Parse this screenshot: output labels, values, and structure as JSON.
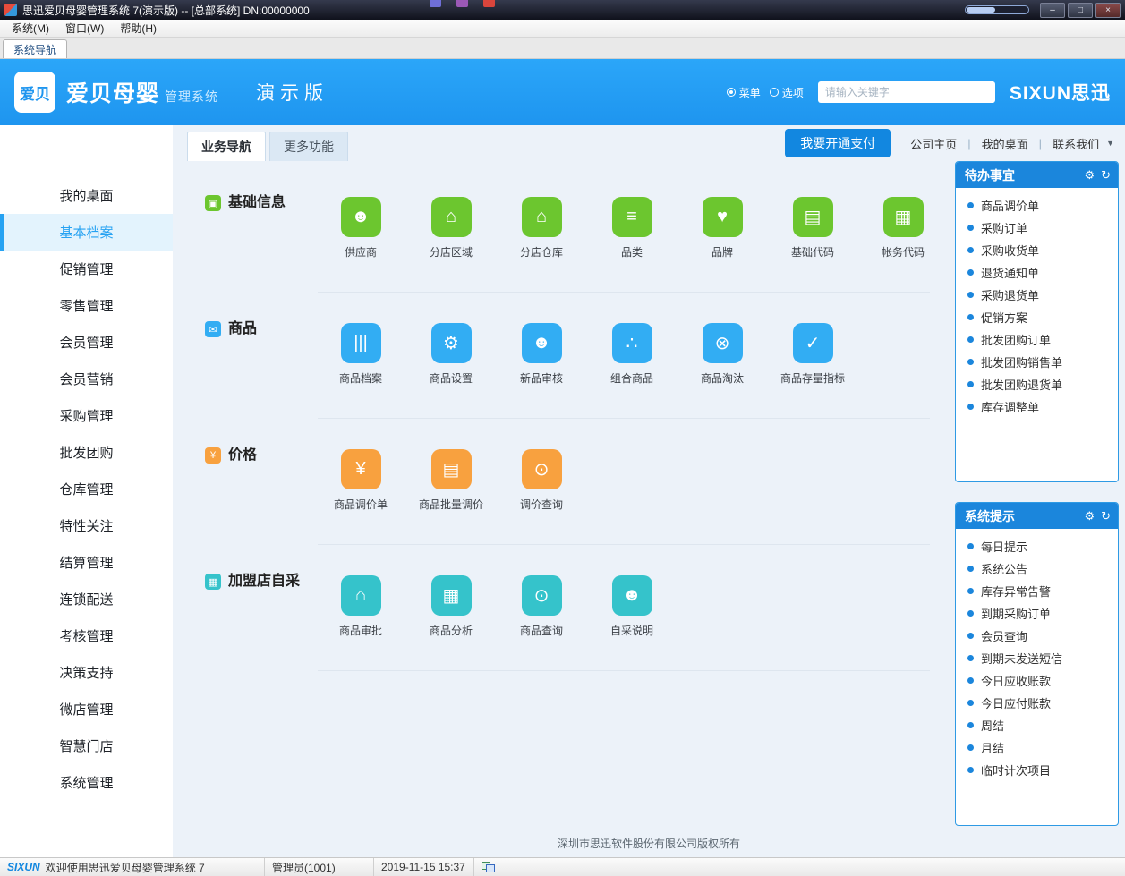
{
  "titlebar": {
    "title": "思迅爱贝母婴管理系统 7(演示版) -- [总部系统] DN:00000000",
    "controls": {
      "minimize": "–",
      "maximize": "□",
      "close": "×"
    },
    "peek_icon_colors": [
      "#6f6fd8",
      "#9b59b6",
      "#d9453c"
    ]
  },
  "menubar": {
    "items": [
      "系统(M)",
      "窗口(W)",
      "帮助(H)"
    ]
  },
  "nav_tab": "系统导航",
  "banner": {
    "logo_badge": "爱贝",
    "brand": "爱贝母婴",
    "brand_suffix": "管理系统",
    "demo_label": "演示版",
    "radio_options": [
      {
        "label": "菜单",
        "selected": true
      },
      {
        "label": "选项",
        "selected": false
      }
    ],
    "search_placeholder": "请输入关键字",
    "vendor_logo": "SIXUN思迅"
  },
  "sidebar": {
    "active": "基本档案",
    "items": [
      "我的桌面",
      "基本档案",
      "促销管理",
      "零售管理",
      "会员管理",
      "会员营销",
      "采购管理",
      "批发团购",
      "仓库管理",
      "特性关注",
      "结算管理",
      "连锁配送",
      "考核管理",
      "决策支持",
      "微店管理",
      "智慧门店",
      "系统管理"
    ]
  },
  "main": {
    "tabs": [
      {
        "label": "业务导航",
        "active": true
      },
      {
        "label": "更多功能",
        "active": false
      }
    ],
    "pay_button": "我要开通支付",
    "links": [
      "公司主页",
      "我的桌面",
      "联系我们"
    ],
    "caret": "▼",
    "sections": [
      {
        "name": "basic-info-section",
        "title": "基础信息",
        "color": "#6cc62f",
        "icon_glyph": "▣",
        "items": [
          {
            "label": "供应商",
            "name": "supplier-icon",
            "glyph": "☻"
          },
          {
            "label": "分店区域",
            "name": "branch-region-icon",
            "glyph": "⌂"
          },
          {
            "label": "分店仓库",
            "name": "branch-warehouse-icon",
            "glyph": "⌂"
          },
          {
            "label": "品类",
            "name": "category-icon",
            "glyph": "≡"
          },
          {
            "label": "品牌",
            "name": "brand-icon",
            "glyph": "♥"
          },
          {
            "label": "基础代码",
            "name": "base-code-icon",
            "glyph": "▤"
          },
          {
            "label": "帐务代码",
            "name": "account-code-icon",
            "glyph": "▦"
          }
        ]
      },
      {
        "name": "product-section",
        "title": "商品",
        "color": "#32adf3",
        "icon_glyph": "✉",
        "items": [
          {
            "label": "商品档案",
            "name": "product-archive-icon",
            "glyph": "|||"
          },
          {
            "label": "商品设置",
            "name": "product-settings-icon",
            "glyph": "⚙"
          },
          {
            "label": "新品审核",
            "name": "new-product-review-icon",
            "glyph": "☻"
          },
          {
            "label": "组合商品",
            "name": "combo-product-icon",
            "glyph": "∴"
          },
          {
            "label": "商品淘汰",
            "name": "product-eliminate-icon",
            "glyph": "⊗"
          },
          {
            "label": "商品存量指标",
            "name": "stock-index-icon",
            "glyph": "✓"
          }
        ]
      },
      {
        "name": "price-section",
        "title": "价格",
        "color": "#f8a13f",
        "icon_glyph": "¥",
        "items": [
          {
            "label": "商品调价单",
            "name": "price-adjust-doc-icon",
            "glyph": "¥"
          },
          {
            "label": "商品批量调价",
            "name": "batch-price-adjust-icon",
            "glyph": "▤"
          },
          {
            "label": "调价查询",
            "name": "price-query-icon",
            "glyph": "⊙"
          }
        ]
      },
      {
        "name": "franchise-section",
        "title": "加盟店自采",
        "color": "#35c3cb",
        "icon_glyph": "▦",
        "items": [
          {
            "label": "商品审批",
            "name": "product-approval-icon",
            "glyph": "⌂"
          },
          {
            "label": "商品分析",
            "name": "product-analysis-icon",
            "glyph": "▦"
          },
          {
            "label": "商品查询",
            "name": "product-query-icon",
            "glyph": "⊙"
          },
          {
            "label": "自采说明",
            "name": "self-purchase-info-icon",
            "glyph": "☻"
          }
        ]
      }
    ],
    "footer": "深圳市思迅软件股份有限公司版权所有"
  },
  "panels": [
    {
      "name": "todo-panel",
      "title": "待办事宜",
      "items": [
        "商品调价单",
        "采购订单",
        "采购收货单",
        "退货通知单",
        "采购退货单",
        "促销方案",
        "批发团购订单",
        "批发团购销售单",
        "批发团购退货单",
        "库存调整单"
      ]
    },
    {
      "name": "system-tips-panel",
      "title": "系统提示",
      "items": [
        "每日提示",
        "系统公告",
        "库存异常告警",
        "到期采购订单",
        "会员查询",
        "到期未发送短信",
        "今日应收账款",
        "今日应付账款",
        "周结",
        "月结",
        "临时计次项目"
      ]
    }
  ],
  "statusbar": {
    "logo": "SIXUN",
    "welcome": "欢迎使用思迅爱贝母婴管理系统 7",
    "user": "管理员(1001)",
    "datetime": "2019-11-15 15:37"
  },
  "colors": {
    "accent_blue": "#1e95ef",
    "panel_blue": "#1b86dc",
    "pay_blue": "#1287e0"
  }
}
